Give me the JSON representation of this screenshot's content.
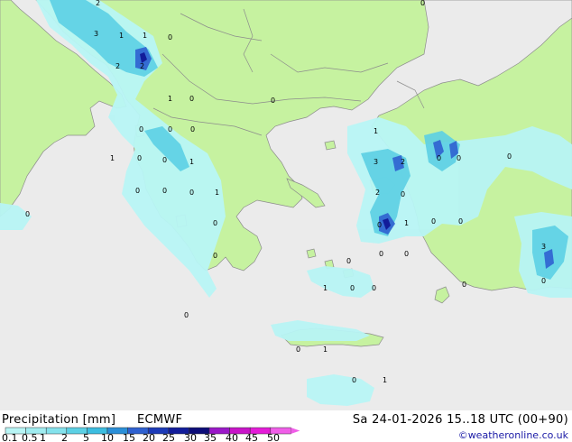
{
  "footer": {
    "title": "Precipitation [mm]",
    "model": "ECMWF",
    "valid": "Sa 24-01-2026 15..18 UTC (00+90)",
    "credit": "©weatheronline.co.uk"
  },
  "legend": {
    "labels": [
      "0.1",
      "0.5",
      "1",
      "2",
      "5",
      "10",
      "15",
      "20",
      "25",
      "30",
      "35",
      "40",
      "45",
      "50"
    ],
    "colors": [
      "#b8f5f5",
      "#a0ecf0",
      "#84e2ec",
      "#5cd0e4",
      "#3cbde0",
      "#2a8fd8",
      "#2f61d0",
      "#1c3ab8",
      "#121c9a",
      "#0c0c78",
      "#9a18c8",
      "#c814c8",
      "#e41cd8",
      "#f05ee8"
    ]
  },
  "map": {
    "sea_color": "#ebebeb",
    "land_color": "#c6f2a0",
    "map_labels": [
      "2",
      "3",
      "1",
      "1",
      "0",
      "2",
      "2",
      "1",
      "0",
      "0",
      "0",
      "0",
      "0",
      "1",
      "0",
      "0",
      "1",
      "0",
      "0",
      "0",
      "1",
      "0",
      "0",
      "0",
      "0",
      "1",
      "3",
      "2",
      "0",
      "2",
      "0",
      "1",
      "0",
      "0",
      "0",
      "0",
      "0",
      "0",
      "1",
      "0",
      "0",
      "0",
      "0",
      "1",
      "0",
      "1",
      "3",
      "0",
      "0",
      "0",
      "0"
    ]
  }
}
